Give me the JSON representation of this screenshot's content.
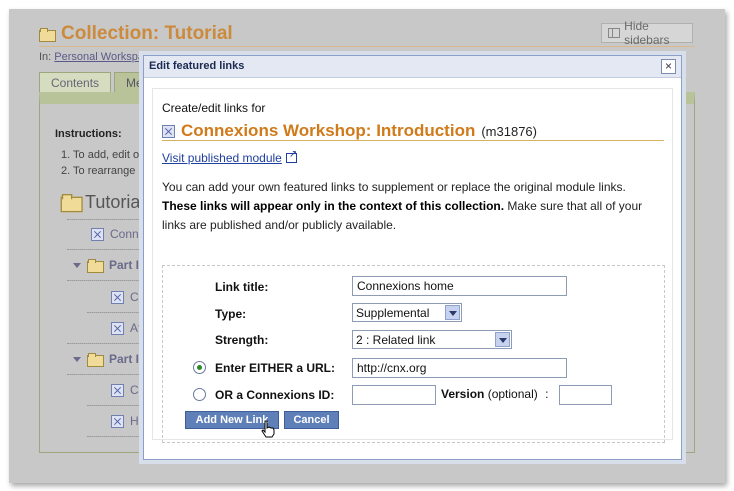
{
  "page": {
    "title": "Collection: Tutorial",
    "hide_sidebars": "Hide sidebars",
    "in_label": "In:",
    "in_link": "Personal Workspa",
    "tabs": [
      "Contents",
      "Meta"
    ],
    "instructions_title": "Instructions:",
    "instructions": [
      "1.  To add, edit o",
      "2.  To rearrange"
    ],
    "tree": {
      "root": "Tutorial",
      "items": [
        "Conne",
        "Part I",
        "Cr",
        "Af",
        "Part I",
        "Cr",
        "Ho"
      ]
    }
  },
  "dialog": {
    "title": "Edit featured links",
    "close_symbol": "×",
    "create_label": "Create/edit links for",
    "module_name": "Connexions Workshop: Introduction",
    "module_id": "(m31876)",
    "visit_link": "Visit published module",
    "desc_plain_1": "You can add your own featured links to supplement or replace the original module links.",
    "desc_bold": "These links will appear only in the context of this collection.",
    "desc_plain_2": "Make sure that all of your links are published and/or publicly available.",
    "form": {
      "link_title_label": "Link title:",
      "link_title_value": "Connexions home",
      "type_label": "Type:",
      "type_value": "Supplemental",
      "strength_label": "Strength:",
      "strength_value": "2 : Related link",
      "url_label": "Enter EITHER a URL:",
      "url_value": "http://cnx.org",
      "cnx_id_label": "OR a Connexions ID:",
      "cnx_id_value": "",
      "version_label": "Version",
      "version_optional": "(optional)",
      "version_colon": ":",
      "version_value": "",
      "url_selected": true
    },
    "buttons": {
      "add": "Add New Link",
      "cancel": "Cancel"
    }
  },
  "colors": {
    "accent_orange": "#d07a1a",
    "dialog_border": "#8aa0c8",
    "button_blue": "#5e7fb8"
  }
}
